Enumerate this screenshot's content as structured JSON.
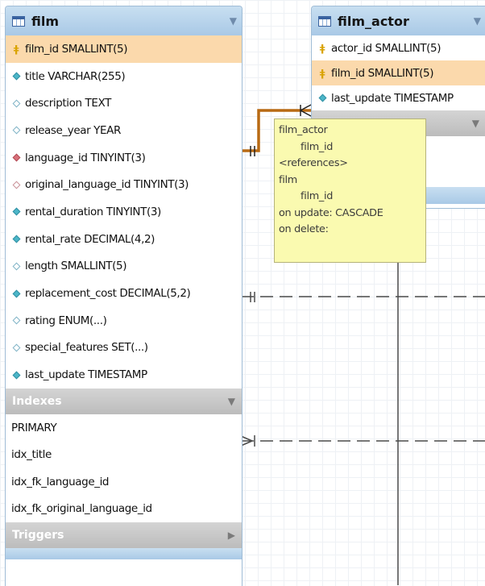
{
  "film_table": {
    "title": "film",
    "columns": [
      {
        "label": "film_id SMALLINT(5)",
        "icon": "primary-key-icon"
      },
      {
        "label": "title VARCHAR(255)",
        "icon": "not-null-column-icon"
      },
      {
        "label": "description TEXT",
        "icon": "nullable-column-icon"
      },
      {
        "label": "release_year YEAR",
        "icon": "nullable-column-icon"
      },
      {
        "label": "language_id TINYINT(3)",
        "icon": "foreign-key-icon"
      },
      {
        "label": "original_language_id TINYINT(3)",
        "icon": "nullable-foreign-key-icon"
      },
      {
        "label": "rental_duration TINYINT(3)",
        "icon": "not-null-column-icon"
      },
      {
        "label": "rental_rate DECIMAL(4,2)",
        "icon": "not-null-column-icon"
      },
      {
        "label": "length SMALLINT(5)",
        "icon": "nullable-column-icon"
      },
      {
        "label": "replacement_cost DECIMAL(5,2)",
        "icon": "not-null-column-icon"
      },
      {
        "label": "rating ENUM(...)",
        "icon": "nullable-column-icon"
      },
      {
        "label": "special_features SET(...)",
        "icon": "nullable-column-icon"
      },
      {
        "label": "last_update TIMESTAMP",
        "icon": "not-null-column-icon"
      }
    ],
    "indexes_label": "Indexes",
    "indexes": [
      "PRIMARY",
      "idx_title",
      "idx_fk_language_id",
      "idx_fk_original_language_id"
    ],
    "triggers_label": "Triggers"
  },
  "film_actor_table": {
    "title": "film_actor",
    "columns": [
      {
        "label": "actor_id SMALLINT(5)",
        "icon": "primary-key-icon"
      },
      {
        "label": "film_id SMALLINT(5)",
        "icon": "primary-key-icon"
      },
      {
        "label": "last_update TIMESTAMP",
        "icon": "not-null-column-icon"
      }
    ]
  },
  "tooltip": {
    "lines": [
      "film_actor",
      "film_id",
      "<references>",
      "film",
      "film_id",
      "on update: CASCADE",
      "on delete:"
    ]
  },
  "colors": {
    "header_blue": "#b9d4ec",
    "highlight_row": "#fbd9ac",
    "relationship_line": "#b86a14",
    "tooltip_bg": "#fafab0",
    "section_gray": "#c6c6c6"
  }
}
